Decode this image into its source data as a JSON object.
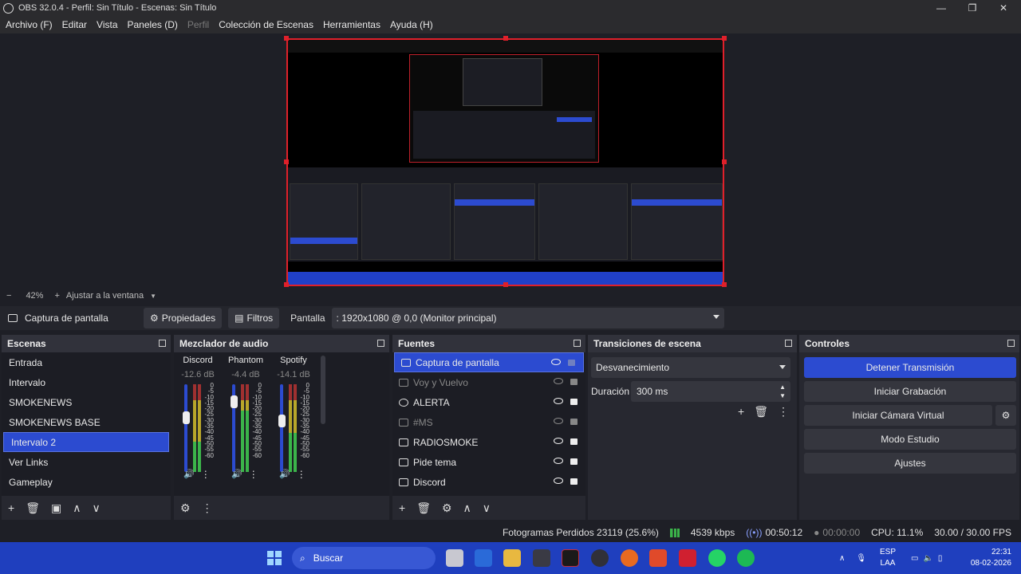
{
  "window": {
    "title": "OBS 32.0.4 - Perfil: Sin Título - Escenas: Sin Título",
    "minimize": "—",
    "maximize": "❐",
    "close": "✕"
  },
  "menu": [
    {
      "label": "Archivo (F)",
      "disabled": false
    },
    {
      "label": "Editar",
      "disabled": false
    },
    {
      "label": "Vista",
      "disabled": false
    },
    {
      "label": "Paneles (D)",
      "disabled": false
    },
    {
      "label": "Perfil",
      "disabled": true
    },
    {
      "label": "Colección de Escenas",
      "disabled": false
    },
    {
      "label": "Herramientas",
      "disabled": false
    },
    {
      "label": "Ayuda (H)",
      "disabled": false
    }
  ],
  "zoom": {
    "minus": "−",
    "value": "42%",
    "plus": "+",
    "fit_label": "Ajustar a la ventana"
  },
  "source_toolbar": {
    "source_name": "Captura de pantalla",
    "properties_label": "Propiedades",
    "filters_label": "Filtros",
    "screen_label": "Pantalla",
    "screen_value": ": 1920x1080 @ 0,0 (Monitor principal)"
  },
  "scenes": {
    "title": "Escenas",
    "items": [
      "Entrada",
      "Intervalo",
      "SMOKENEWS",
      "SMOKENEWS BASE",
      "Intervalo 2",
      "Ver Links",
      "Gameplay"
    ],
    "selected_index": 4
  },
  "mixer": {
    "title": "Mezclador de audio",
    "scale": [
      "0",
      "-5",
      "-10",
      "-15",
      "-20",
      "-25",
      "-30",
      "-35",
      "-40",
      "-45",
      "-50",
      "-55",
      "-60"
    ],
    "channels": [
      {
        "name": "Discord",
        "db": "-12.6 dB",
        "level": 0.35,
        "fader": 0.62
      },
      {
        "name": "Phantom",
        "db": "-4.4 dB",
        "level": 0.7,
        "fader": 0.8
      },
      {
        "name": "Spotify",
        "db": "-14.1 dB",
        "level": 0.45,
        "fader": 0.58
      }
    ]
  },
  "sources": {
    "title": "Fuentes",
    "items": [
      {
        "name": "Captura de pantalla",
        "visible": true,
        "locked": false,
        "selected": true
      },
      {
        "name": "Voy y Vuelvo",
        "visible": false,
        "locked": true,
        "selected": false
      },
      {
        "name": "ALERTA",
        "visible": true,
        "locked": true,
        "selected": false
      },
      {
        "name": "#MS",
        "visible": false,
        "locked": true,
        "selected": false
      },
      {
        "name": "RADIOSMOKE",
        "visible": true,
        "locked": true,
        "selected": false
      },
      {
        "name": "Pide tema",
        "visible": true,
        "locked": true,
        "selected": false
      },
      {
        "name": "Discord",
        "visible": true,
        "locked": true,
        "selected": false
      }
    ]
  },
  "transitions": {
    "title": "Transiciones de escena",
    "selected": "Desvanecimiento",
    "duration_label": "Duración",
    "duration_value": "300 ms"
  },
  "controls": {
    "title": "Controles",
    "stop_stream": "Detener Transmisión",
    "start_recording": "Iniciar Grabación",
    "start_virtual_cam": "Iniciar Cámara Virtual",
    "studio_mode": "Modo Estudio",
    "settings": "Ajustes"
  },
  "status": {
    "dropped_frames": "Fotogramas Perdidos 23119 (25.6%)",
    "bitrate": "4539 kbps",
    "stream_time": "00:50:12",
    "record_time": "00:00:00",
    "cpu": "CPU: 11.1%",
    "fps": "30.00 / 30.00 FPS"
  },
  "taskbar": {
    "search_placeholder": "Buscar",
    "lang_top": "ESP",
    "lang_bottom": "LAA",
    "time": "22:31",
    "date": "08-02-2026",
    "colors": {
      "background": "#1f3fbe",
      "accent": "#2c4bd0"
    }
  }
}
